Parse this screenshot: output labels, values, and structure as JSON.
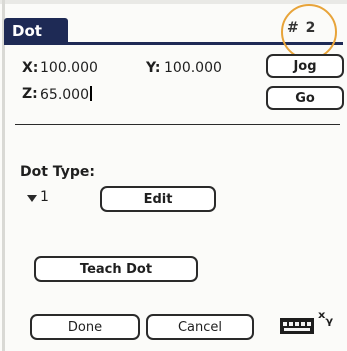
{
  "window": {
    "title": "Dot",
    "record": "# 2"
  },
  "coords": {
    "x_label": "X:",
    "x_value": "100.000",
    "y_label": "Y:",
    "y_value": "100.000",
    "z_label": "Z:",
    "z_value": "65.000"
  },
  "buttons": {
    "jog": "Jog",
    "go": "Go",
    "edit": "Edit",
    "teach_dot": "Teach Dot",
    "done": "Done",
    "cancel": "Cancel"
  },
  "dot_type": {
    "label": "Dot Type:",
    "selected": "1"
  },
  "icons": {
    "dropdown": "triangle-down-icon",
    "keyboard": "keyboard-icon",
    "graffiti": "xy-graffiti-icon"
  },
  "colors": {
    "title_bar": "#1e2a55",
    "highlight_ring": "#e8a43a",
    "screen": "#fbfbf9"
  }
}
